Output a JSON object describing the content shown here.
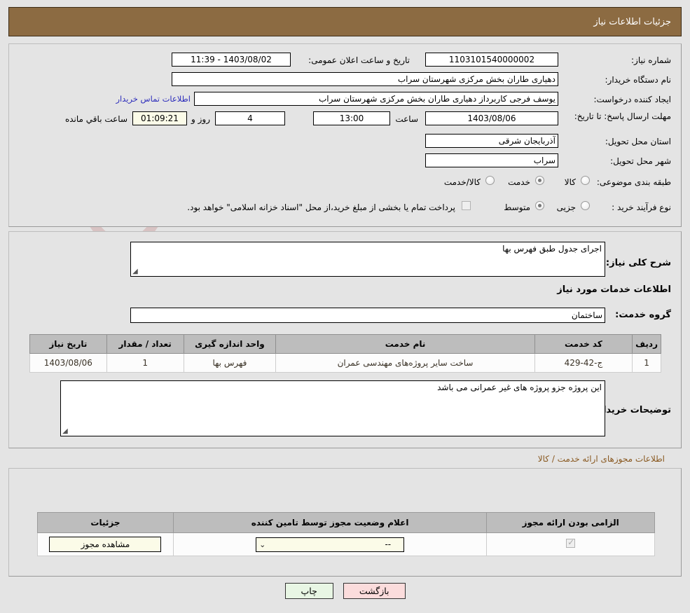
{
  "header": {
    "title": "جزئیات اطلاعات نیاز"
  },
  "watermark": {
    "text": "AriaTender.net"
  },
  "top_form": {
    "need_number_label": "شماره نیاز:",
    "need_number_value": "1103101540000002",
    "announce_label": "تاریخ و ساعت اعلان عمومی:",
    "announce_value": "1403/08/02 - 11:39",
    "buyer_org_label": "نام دستگاه خریدار:",
    "buyer_org_value": "دهیاری طاران بخش مرکزی شهرستان سراب",
    "creator_label": "ایجاد کننده درخواست:",
    "creator_value": "یوسف فرجی کاربرداز دهیاری طاران بخش مرکزی شهرستان سراب",
    "contact_link": "اطلاعات تماس خریدار",
    "deadline_label": "مهلت ارسال پاسخ: تا تاریخ:",
    "deadline_date": "1403/08/06",
    "deadline_time_label": "ساعت",
    "deadline_time": "13:00",
    "days_value": "4",
    "days_unit_label": "روز و",
    "countdown_value": "01:09:21",
    "countdown_suffix_label": "ساعت باقي مانده",
    "province_label": "استان محل تحویل:",
    "province_value": "آذربایجان شرقی",
    "city_label": "شهر محل تحویل:",
    "city_value": "سراب",
    "category_label": "طبقه بندی موضوعی:",
    "category_options": [
      {
        "label": "کالا",
        "selected": false
      },
      {
        "label": "خدمت",
        "selected": true
      },
      {
        "label": "کالا/خدمت",
        "selected": false
      }
    ],
    "process_label": "نوع فرآیند خرید :",
    "process_options": [
      {
        "label": "جزیی",
        "selected": false
      },
      {
        "label": "متوسط",
        "selected": true
      }
    ],
    "treasury_checkbox_checked": false,
    "treasury_text": "پرداخت تمام یا بخشی از مبلغ خرید،از محل \"اسناد خزانه اسلامی\" خواهد بود."
  },
  "detail": {
    "general_desc_label": "شرح کلی نیاز:",
    "general_desc_value": "اجرای جدول طبق فهرس بها",
    "services_heading": "اطلاعات خدمات مورد نیاز",
    "service_group_label": "گروه خدمت:",
    "service_group_value": "ساختمان",
    "table": {
      "columns": [
        "ردیف",
        "کد خدمت",
        "نام خدمت",
        "واحد اندازه گیری",
        "تعداد / مقدار",
        "تاریخ نیاز"
      ],
      "rows": [
        [
          "1",
          "ج-42-429",
          "ساخت سایر پروژه‌های مهندسی عمران",
          "فهرس بها",
          "1",
          "1403/08/06"
        ]
      ]
    },
    "buyer_notes_label": "توضیحات خریدار:",
    "buyer_notes_value": "این پروژه جزو پروژه های غیر عمرانی می باشد"
  },
  "permits": {
    "title": "اطلاعات مجوزهای ارائه خدمت / کالا",
    "columns": [
      "الزامی بودن ارائه مجوز",
      "اعلام وضعیت مجوز توسط تامین کننده",
      "جزئیات"
    ],
    "rows": [
      {
        "required_checked": true,
        "status_value": "--",
        "details_button": "مشاهده مجوز"
      }
    ]
  },
  "footer": {
    "print_label": "چاپ",
    "back_label": "بازگشت"
  }
}
